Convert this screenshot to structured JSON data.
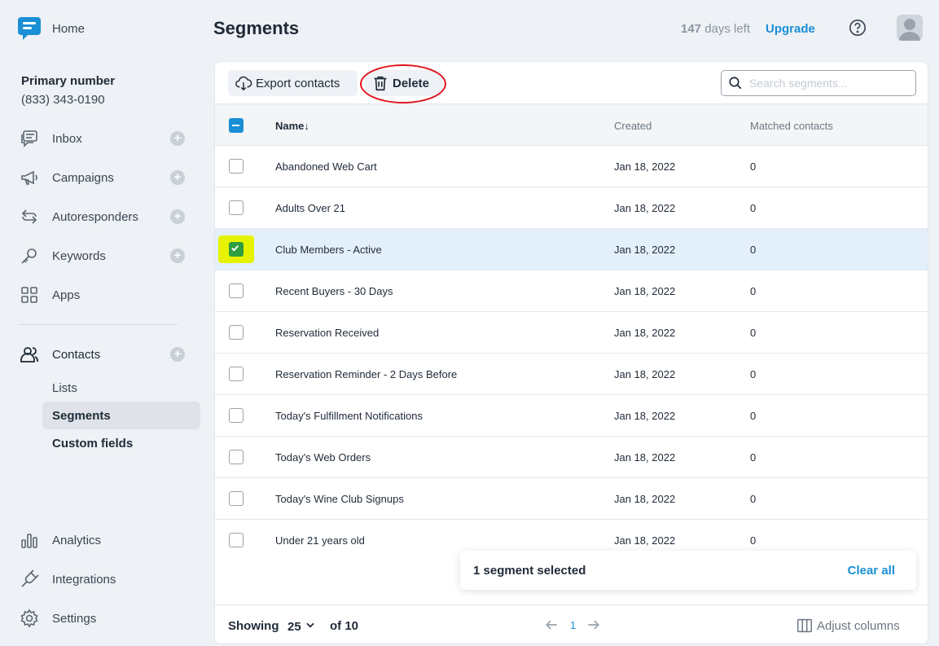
{
  "sidebar": {
    "home_label": "Home",
    "primary_title": "Primary number",
    "primary_number": "(833) 343-0190",
    "nav": {
      "inbox": "Inbox",
      "campaigns": "Campaigns",
      "autoresponders": "Autoresponders",
      "keywords": "Keywords",
      "apps": "Apps",
      "contacts": "Contacts",
      "analytics": "Analytics",
      "integrations": "Integrations",
      "settings": "Settings"
    },
    "contacts_sub": {
      "lists": "Lists",
      "segments": "Segments",
      "custom_fields": "Custom fields"
    },
    "plus_symbol": "+"
  },
  "header": {
    "title": "Segments",
    "days_left_num": "147",
    "days_left_text": "days left",
    "upgrade": "Upgrade"
  },
  "toolbar": {
    "export_label": "Export contacts",
    "delete_label": "Delete",
    "search_placeholder": "Search segments..."
  },
  "table": {
    "columns": {
      "name": "Name",
      "name_sort": "↓",
      "created": "Created",
      "matched": "Matched contacts"
    },
    "rows": [
      {
        "name": "Abandoned Web Cart",
        "created": "Jan 18, 2022",
        "matched": "0"
      },
      {
        "name": "Adults Over 21",
        "created": "Jan 18, 2022",
        "matched": "0"
      },
      {
        "name": "Club Members - Active",
        "created": "Jan 18, 2022",
        "matched": "0"
      },
      {
        "name": "Recent Buyers - 30 Days",
        "created": "Jan 18, 2022",
        "matched": "0"
      },
      {
        "name": "Reservation Received",
        "created": "Jan 18, 2022",
        "matched": "0"
      },
      {
        "name": "Reservation Reminder - 2 Days Before",
        "created": "Jan 18, 2022",
        "matched": "0"
      },
      {
        "name": "Today's Fulfillment Notifications",
        "created": "Jan 18, 2022",
        "matched": "0"
      },
      {
        "name": "Today's Web Orders",
        "created": "Jan 18, 2022",
        "matched": "0"
      },
      {
        "name": "Today's Wine Club Signups",
        "created": "Jan 18, 2022",
        "matched": "0"
      },
      {
        "name": "Under 21 years old",
        "created": "Jan 18, 2022",
        "matched": "0"
      }
    ]
  },
  "selection": {
    "text": "1 segment selected",
    "clear_all": "Clear all"
  },
  "footer": {
    "showing": "Showing",
    "page_size": "25",
    "of_total": "of 10",
    "current_page": "1",
    "adjust_columns": "Adjust columns"
  },
  "colors": {
    "accent": "#1a8fd6",
    "check_green": "#2e9e3e",
    "highlight_yellow": "#e6f200",
    "annotation_red": "#e0161e"
  }
}
